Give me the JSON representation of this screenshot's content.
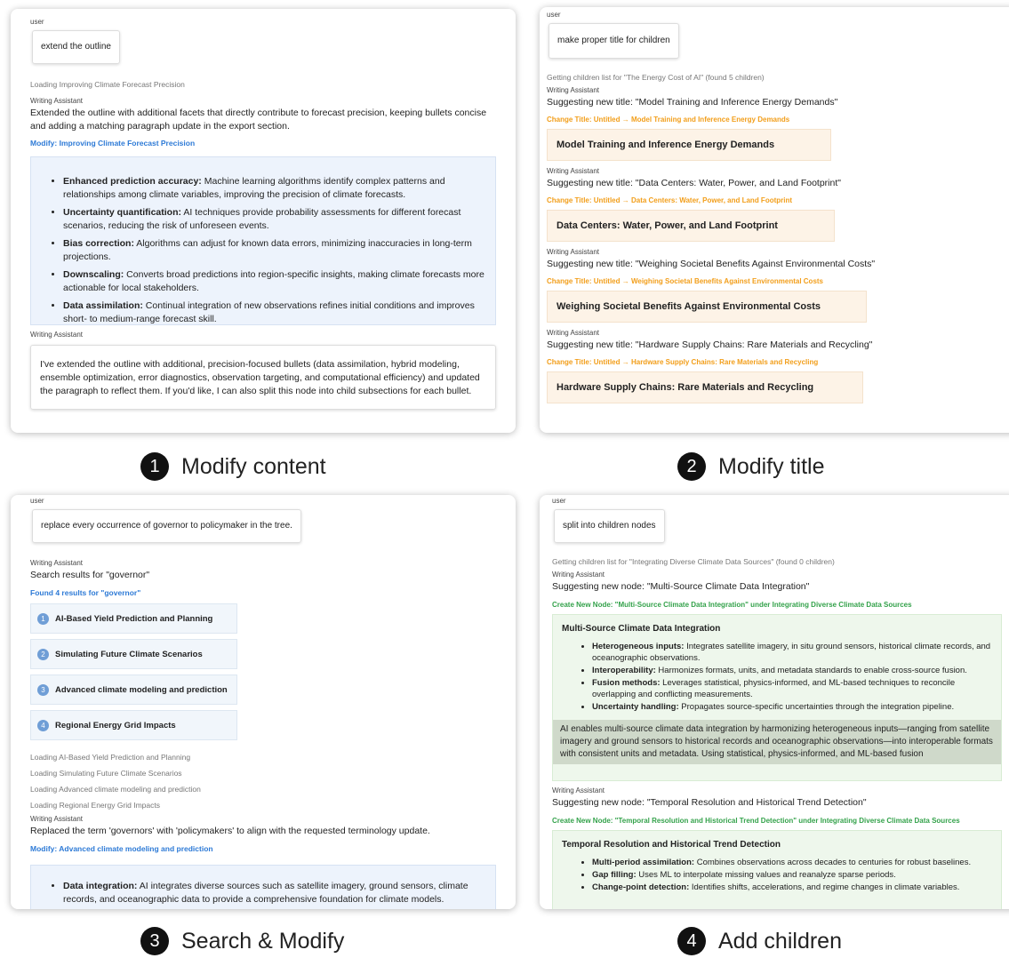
{
  "panel1": {
    "user_label": "user",
    "prompt": "extend the outline",
    "loading": "Loading Improving Climate Forecast Precision",
    "assistant_label": "Writing Assistant",
    "reply": "Extended the outline with additional facets that directly contribute to forecast precision, keeping bullets concise and adding a matching paragraph update in the export section.",
    "action": "Modify: Improving Climate Forecast Precision",
    "bullets": [
      {
        "bold": "Enhanced prediction accuracy:",
        "text": " Machine learning algorithms identify complex patterns and relationships among climate variables, improving the precision of climate forecasts."
      },
      {
        "bold": "Uncertainty quantification:",
        "text": " AI techniques provide probability assessments for different forecast scenarios, reducing the risk of unforeseen events."
      },
      {
        "bold": "Bias correction:",
        "text": " Algorithms can adjust for known data errors, minimizing inaccuracies in long-term projections."
      },
      {
        "bold": "Downscaling:",
        "text": " Converts broad predictions into region-specific insights, making climate forecasts more actionable for local stakeholders."
      },
      {
        "bold": "Data assimilation:",
        "text": " Continual integration of new observations refines initial conditions and improves short- to medium-range forecast skill."
      }
    ],
    "assistant_label2": "Writing Assistant",
    "final": "I've extended the outline with additional, precision-focused bullets (data assimilation, hybrid modeling, ensemble optimization, error diagnostics, observation targeting, and computational efficiency) and updated the paragraph to reflect them. If you'd like, I can also split this node into child subsections for each bullet."
  },
  "panel2": {
    "user_label": "user",
    "prompt": "make proper title for children",
    "loading": "Getting children list for \"The Energy Cost of AI\" (found 5 children)",
    "entries": [
      {
        "assistant": "Writing Assistant",
        "suggest": "Suggesting new title: \"Model Training and Inference Energy Demands\"",
        "change": "Change Title: Untitled → Model Training and Inference Energy Demands",
        "title": "Model Training and Inference Energy Demands"
      },
      {
        "assistant": "Writing Assistant",
        "suggest": "Suggesting new title: \"Data Centers: Water, Power, and Land Footprint\"",
        "change": "Change Title: Untitled → Data Centers: Water, Power, and Land Footprint",
        "title": "Data Centers: Water, Power, and Land Footprint"
      },
      {
        "assistant": "Writing Assistant",
        "suggest": "Suggesting new title: \"Weighing Societal Benefits Against Environmental Costs\"",
        "change": "Change Title: Untitled → Weighing Societal Benefits Against Environmental Costs",
        "title": "Weighing Societal Benefits Against Environmental Costs"
      },
      {
        "assistant": "Writing Assistant",
        "suggest": "Suggesting new title: \"Hardware Supply Chains: Rare Materials and Recycling\"",
        "change": "Change Title: Untitled → Hardware Supply Chains: Rare Materials and Recycling",
        "title": "Hardware Supply Chains: Rare Materials and Recycling"
      }
    ]
  },
  "panel3": {
    "user_label": "user",
    "prompt": "replace every occurrence of governor to policymaker in the tree.",
    "assistant_label": "Writing Assistant",
    "search": "Search results for \"governor\"",
    "found": "Found 4 results for \"governor\"",
    "results": [
      {
        "n": "1",
        "title": "AI-Based Yield Prediction and Planning"
      },
      {
        "n": "2",
        "title": "Simulating Future Climate Scenarios"
      },
      {
        "n": "3",
        "title": "Advanced climate modeling and prediction"
      },
      {
        "n": "4",
        "title": "Regional Energy Grid Impacts"
      }
    ],
    "loading": [
      "Loading AI-Based Yield Prediction and Planning",
      "Loading Simulating Future Climate Scenarios",
      "Loading Advanced climate modeling and prediction",
      "Loading Regional Energy Grid Impacts"
    ],
    "assistant_label2": "Writing Assistant",
    "reply": "Replaced the term 'governors' with 'policymakers' to align with the requested terminology update.",
    "action": "Modify: Advanced climate modeling and prediction",
    "bullet": {
      "bold": "Data integration:",
      "text": " AI integrates diverse sources such as satellite imagery, ground sensors, climate records, and oceanographic data to provide a comprehensive foundation for climate models."
    }
  },
  "panel4": {
    "user_label": "user",
    "prompt": "split into children nodes",
    "loading": "Getting children list for \"Integrating Diverse Climate Data Sources\" (found 0 children)",
    "assistant_label": "Writing Assistant",
    "suggest1": "Suggesting new node: \"Multi-Source Climate Data Integration\"",
    "create1": "Create New Node: \"Multi-Source Climate Data Integration\" under Integrating Diverse Climate Data Sources",
    "node1": {
      "title": "Multi-Source Climate Data Integration",
      "bullets": [
        {
          "bold": "Heterogeneous inputs:",
          "text": " Integrates satellite imagery, in situ ground sensors, historical climate records, and oceanographic observations."
        },
        {
          "bold": "Interoperability:",
          "text": " Harmonizes formats, units, and metadata standards to enable cross-source fusion."
        },
        {
          "bold": "Fusion methods:",
          "text": " Leverages statistical, physics-informed, and ML-based techniques to reconcile overlapping and conflicting measurements."
        },
        {
          "bold": "Uncertainty handling:",
          "text": " Propagates source-specific uncertainties through the integration pipeline."
        }
      ],
      "paragraph": "AI enables multi-source climate data integration by harmonizing heterogeneous inputs—ranging from satellite imagery and ground sensors to historical records and oceanographic observations—into interoperable formats with consistent units and metadata. Using statistical, physics-informed, and ML-based fusion"
    },
    "assistant_label2": "Writing Assistant",
    "suggest2": "Suggesting new node: \"Temporal Resolution and Historical Trend Detection\"",
    "create2": "Create New Node: \"Temporal Resolution and Historical Trend Detection\" under Integrating Diverse Climate Data Sources",
    "node2": {
      "title": "Temporal Resolution and Historical Trend Detection",
      "bullets": [
        {
          "bold": "Multi-period assimilation:",
          "text": " Combines observations across decades to centuries for robust baselines."
        },
        {
          "bold": "Gap filling:",
          "text": " Uses ML to interpolate missing values and reanalyze sparse periods."
        },
        {
          "bold": "Change-point detection:",
          "text": " Identifies shifts, accelerations, and regime changes in climate variables."
        }
      ]
    }
  },
  "captions": [
    {
      "n": "1",
      "label": "Modify content"
    },
    {
      "n": "2",
      "label": "Modify title"
    },
    {
      "n": "3",
      "label": "Search & Modify"
    },
    {
      "n": "4",
      "label": "Add children"
    }
  ]
}
